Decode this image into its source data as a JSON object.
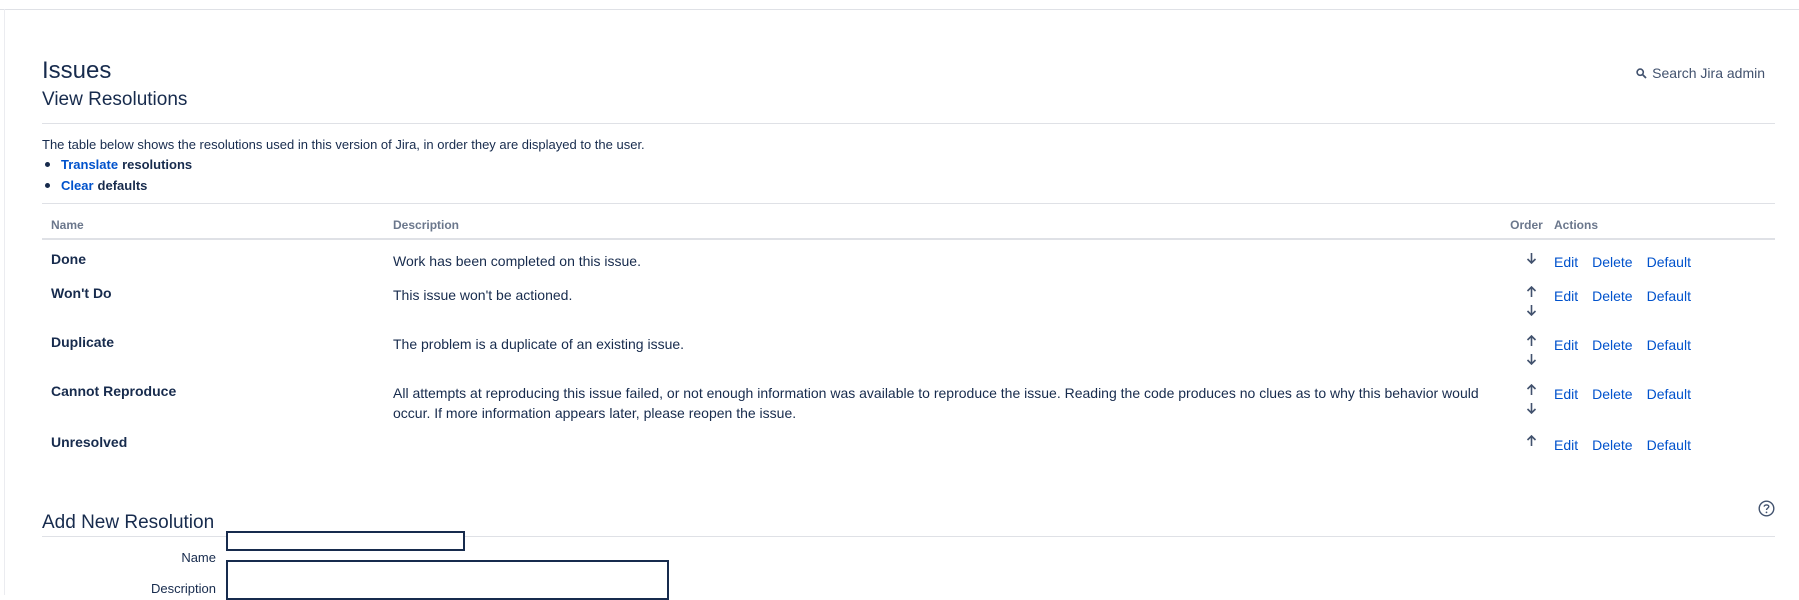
{
  "page": {
    "title": "Issues"
  },
  "search": {
    "label": "Search Jira admin",
    "icon": "search-icon"
  },
  "view_resolutions": {
    "title": "View Resolutions",
    "intro": "The table below shows the resolutions used in this version of Jira, in order they are displayed to the user.",
    "links": [
      {
        "link": "Translate",
        "suffix": "resolutions"
      },
      {
        "link": "Clear",
        "suffix": "defaults"
      }
    ]
  },
  "table": {
    "headers": {
      "name": "Name",
      "description": "Description",
      "order": "Order",
      "actions": "Actions"
    },
    "rows": [
      {
        "name": "Done",
        "description": "Work has been completed on this issue.",
        "up": false,
        "down": true
      },
      {
        "name": "Won't Do",
        "description": "This issue won't be actioned.",
        "up": true,
        "down": true
      },
      {
        "name": "Duplicate",
        "description": "The problem is a duplicate of an existing issue.",
        "up": true,
        "down": true
      },
      {
        "name": "Cannot Reproduce",
        "description": "All attempts at reproducing this issue failed, or not enough information was available to reproduce the issue. Reading the code produces no clues as to why this behavior would occur. If more information appears later, please reopen the issue.",
        "up": true,
        "down": true
      },
      {
        "name": "Unresolved",
        "description": "",
        "up": true,
        "down": false
      }
    ],
    "actions": {
      "edit": "Edit",
      "delete": "Delete",
      "default": "Default"
    }
  },
  "add_resolution": {
    "title": "Add New Resolution",
    "name_label": "Name",
    "name_value": "",
    "description_label": "Description",
    "description_value": "",
    "help_icon": "help-icon"
  },
  "colors": {
    "link": "#0052cc",
    "text": "#172b4d",
    "header": "#6b778c",
    "rule": "#dfe1e6"
  }
}
